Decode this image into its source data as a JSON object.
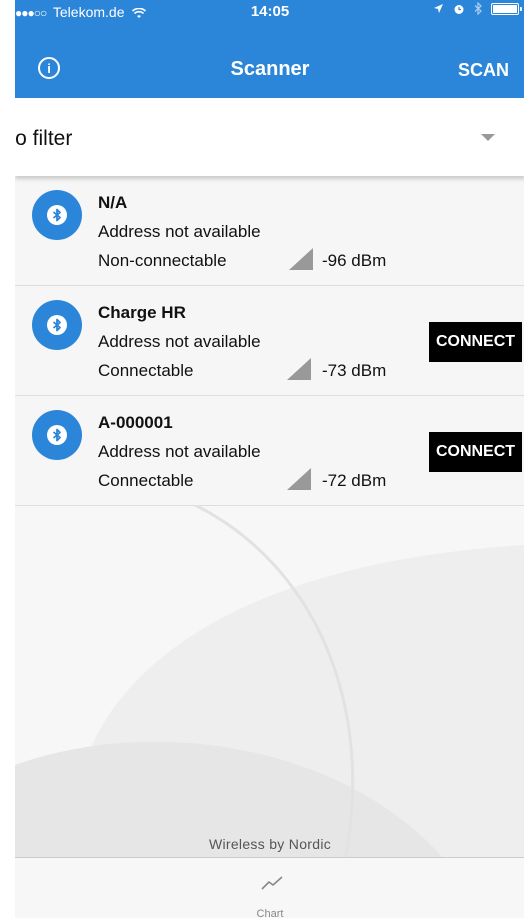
{
  "status_bar": {
    "carrier": "Telekom.de",
    "time": "14:05",
    "signal_dots": "●●●○○",
    "icons": [
      "wifi-icon",
      "location-icon",
      "alarm-icon",
      "bluetooth-icon",
      "battery-icon"
    ]
  },
  "nav": {
    "info_icon": "i",
    "title": "Scanner",
    "scan_label": "SCAN"
  },
  "filter": {
    "selected": "No filter"
  },
  "devices": [
    {
      "name": "N/A",
      "address": "Address not available",
      "connectable": "Non-connectable",
      "rssi": "-96  dBm",
      "connect_label": ""
    },
    {
      "name": "Charge HR",
      "address": "Address not available",
      "connectable": "Connectable",
      "rssi": "-73  dBm",
      "connect_label": "CONNECT"
    },
    {
      "name": "A-000001",
      "address": "Address not available",
      "connectable": "Connectable",
      "rssi": "-72  dBm",
      "connect_label": "CONNECT"
    }
  ],
  "footer": {
    "text": "Wireless by Nordic"
  },
  "tabs": [
    {
      "label": "Chart",
      "icon": "chart-line-icon"
    }
  ],
  "colors": {
    "accent": "#2b86d9",
    "button": "#000000",
    "signal": "#999999"
  }
}
